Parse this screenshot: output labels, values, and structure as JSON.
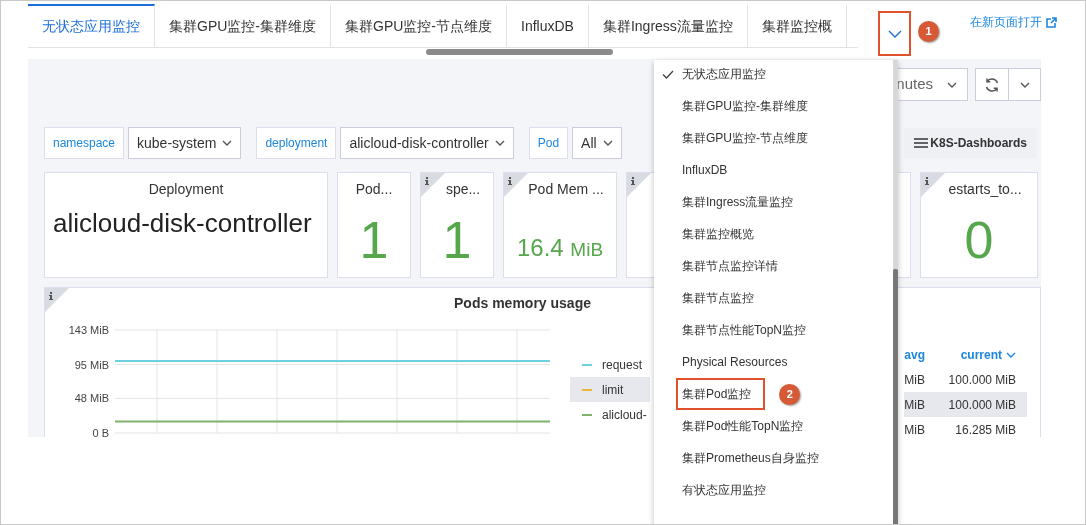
{
  "tabs": [
    {
      "label": "无状态应用监控",
      "selected": true
    },
    {
      "label": "集群GPU监控-集群维度",
      "selected": false
    },
    {
      "label": "集群GPU监控-节点维度",
      "selected": false
    },
    {
      "label": "InfluxDB",
      "selected": false
    },
    {
      "label": "集群Ingress流量监控",
      "selected": false
    },
    {
      "label": "集群监控概",
      "selected": false
    }
  ],
  "more_tabs_button": {
    "callout": "1"
  },
  "open_in_new_page": "在新页面打开",
  "time_range": {
    "value": "nutes"
  },
  "variables": [
    {
      "label": "namespace",
      "value": "kube-system"
    },
    {
      "label": "deployment",
      "value": "alicloud-disk-controller"
    },
    {
      "label": "Pod",
      "value": "All"
    }
  ],
  "dashboards_button": "K8S-Dashboards",
  "stat_panels": [
    {
      "kind": "text",
      "title": "Deployment",
      "value": "alicloud-disk-controller",
      "info": false
    },
    {
      "kind": "number",
      "title": "Pod...",
      "value": "1",
      "info": false
    },
    {
      "kind": "number",
      "title": "spe...",
      "value": "1",
      "info": true
    },
    {
      "kind": "number",
      "title": "Pod Mem ...",
      "value": "16.4",
      "unit": "MiB",
      "info": true
    },
    {
      "kind": "covered",
      "info": true
    },
    {
      "kind": "number",
      "title": "estarts_to...",
      "value": "0",
      "info": true
    }
  ],
  "chart_panel": {
    "title": "Pods memory usage",
    "info": true,
    "chart_data": {
      "type": "line",
      "ylim": [
        0,
        143
      ],
      "yticks": [
        {
          "value": 0,
          "label": "0 B"
        },
        {
          "value": 48,
          "label": "48 MiB"
        },
        {
          "value": 95,
          "label": "95 MiB"
        },
        {
          "value": 143,
          "label": "143 MiB"
        }
      ],
      "series": [
        {
          "name": "request",
          "color": "#6ed0e0",
          "values": [
            100,
            100,
            100,
            100,
            100,
            100,
            100,
            100
          ]
        },
        {
          "name": "limit",
          "color": "#eab839"
        },
        {
          "name": "alicloud-",
          "color": "#7eb26d",
          "values": [
            16,
            16,
            16,
            16,
            16,
            16,
            16,
            16
          ]
        }
      ]
    },
    "legend_columns": [
      "avg",
      "current"
    ],
    "legend_rows": [
      {
        "highlighted": false,
        "avg": "MiB",
        "current": "100.000 MiB"
      },
      {
        "highlighted": true,
        "avg": "MiB",
        "current": "100.000 MiB"
      },
      {
        "highlighted": false,
        "avg": "MiB",
        "current": "16.285 MiB"
      }
    ]
  },
  "dashboard_menu": [
    {
      "label": "无状态应用监控",
      "selected": true
    },
    {
      "label": "集群GPU监控-集群维度",
      "selected": false
    },
    {
      "label": "集群GPU监控-节点维度",
      "selected": false
    },
    {
      "label": "InfluxDB",
      "selected": false
    },
    {
      "label": "集群Ingress流量监控",
      "selected": false
    },
    {
      "label": "集群监控概览",
      "selected": false
    },
    {
      "label": "集群节点监控详情",
      "selected": false
    },
    {
      "label": "集群节点监控",
      "selected": false
    },
    {
      "label": "集群节点性能TopN监控",
      "selected": false
    },
    {
      "label": "Physical Resources",
      "selected": false
    },
    {
      "label": "集群Pod监控",
      "selected": false,
      "callout": "2"
    },
    {
      "label": "集群Pod性能TopN监控",
      "selected": false
    },
    {
      "label": "集群Prometheus自身监控",
      "selected": false
    },
    {
      "label": "有状态应用监控",
      "selected": false
    }
  ]
}
